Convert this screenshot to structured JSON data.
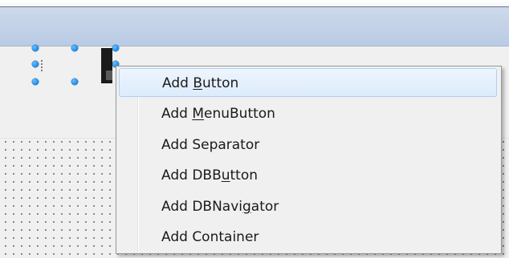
{
  "context_menu": {
    "items": [
      {
        "pre": "Add ",
        "accel": "B",
        "post": "utton",
        "full": "Add Button",
        "state": "hovered"
      },
      {
        "pre": "Add ",
        "accel": "M",
        "post": "enuButton",
        "full": "Add MenuButton",
        "state": "normal"
      },
      {
        "pre": "Add Separator",
        "accel": "",
        "post": "",
        "full": "Add Separator",
        "state": "normal"
      },
      {
        "pre": "Add DBB",
        "accel": "u",
        "post": "tton",
        "full": "Add DBButton",
        "state": "normal"
      },
      {
        "pre": "Add DBNavi",
        "accel": "g",
        "post": "ator",
        "full": "Add DBNavigator",
        "state": "normal"
      },
      {
        "pre": "Add Container",
        "accel": "",
        "post": "",
        "full": "Add Container",
        "state": "normal"
      }
    ]
  },
  "designer": {
    "selected_component_icon": "toolbar-component-icon",
    "selection_handle_icon": "selection-handle-icon"
  },
  "colors": {
    "toolbar_band": "#c3d3e8",
    "menu_background": "#f0f0f0",
    "hover_fill": "#dcebfc",
    "hover_border": "#aecff7",
    "handle_blue": "#1a86e6"
  }
}
